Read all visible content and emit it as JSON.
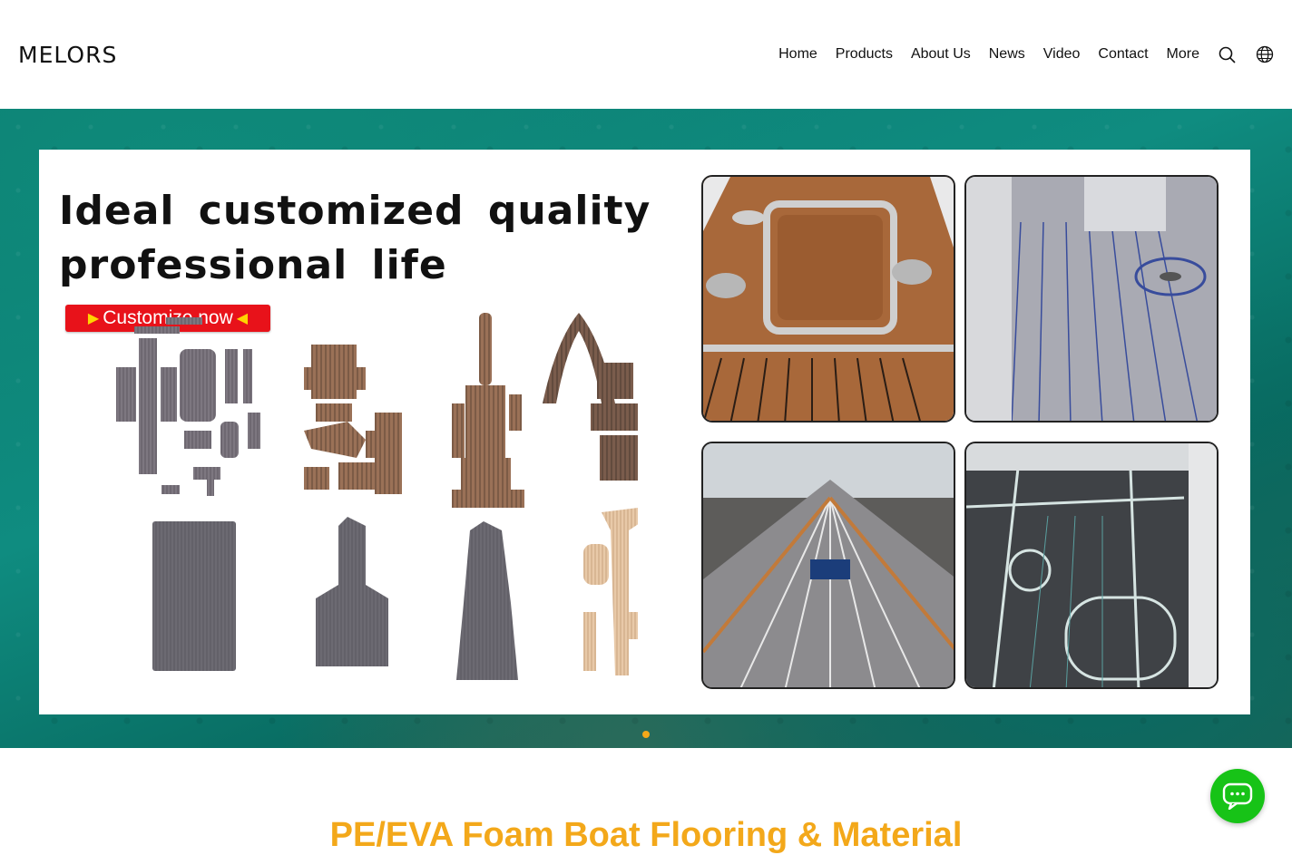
{
  "header": {
    "logo": "MELORS",
    "nav": [
      "Home",
      "Products",
      "About Us",
      "News",
      "Video",
      "Contact",
      "More"
    ],
    "icons": [
      "search-icon",
      "globe-icon"
    ]
  },
  "hero": {
    "title_line1": "Ideal customized quality",
    "title_line2": "professional life",
    "cta_label": "Customize now",
    "slide_count": 1,
    "active_slide": 1
  },
  "section": {
    "title": "PE/EVA Foam Boat Flooring & Material"
  },
  "colors": {
    "accent": "#f3a81a",
    "cta": "#e8121a",
    "chat": "#17c317",
    "teal_ocean": "#0a7c72"
  }
}
